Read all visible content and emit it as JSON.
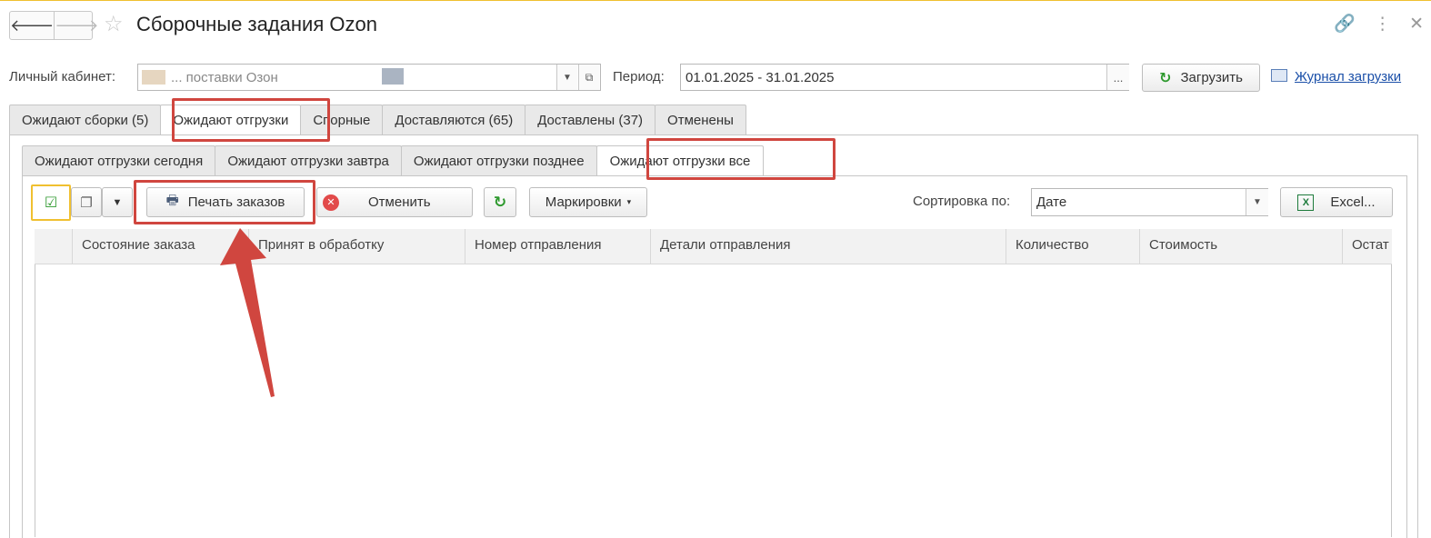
{
  "window": {
    "title": "Сборочные задания Ozon",
    "back_icon": "arrow-left-icon",
    "forward_icon": "arrow-right-icon",
    "favorite_icon": "star-icon"
  },
  "filter": {
    "cabinet_label": "Личный кабинет:",
    "cabinet_value": "... поставки Озон",
    "period_label": "Период:",
    "period_value": "01.01.2025 - 31.01.2025",
    "period_btn": "...",
    "load_button": "Загрузить",
    "journal_link": "Журнал загрузки"
  },
  "tabs": [
    {
      "label": "Ожидают сборки (5)"
    },
    {
      "label": "Ожидают отгрузки"
    },
    {
      "label": "Спорные"
    },
    {
      "label": "Доставляются (65)"
    },
    {
      "label": "Доставлены (37)"
    },
    {
      "label": "Отменены"
    }
  ],
  "subtabs": [
    {
      "label": "Ожидают отгрузки сегодня"
    },
    {
      "label": "Ожидают отгрузки завтра"
    },
    {
      "label": "Ожидают отгрузки позднее"
    },
    {
      "label": "Ожидают отгрузки все"
    }
  ],
  "toolbar": {
    "print_button": "Печать заказов",
    "cancel_button": "Отменить",
    "markings_button": "Маркировки",
    "sort_label": "Сортировка по:",
    "sort_value": "Дате",
    "excel_button": "Excel..."
  },
  "table": {
    "columns": [
      "Состояние заказа",
      "Принят в обработку",
      "Номер отправления",
      "Детали отправления",
      "Количество",
      "Стоимость",
      "Остат"
    ]
  },
  "colors": {
    "highlight": "#d0463f",
    "accent_green": "#2f9a2f",
    "link": "#1a4fa8"
  }
}
